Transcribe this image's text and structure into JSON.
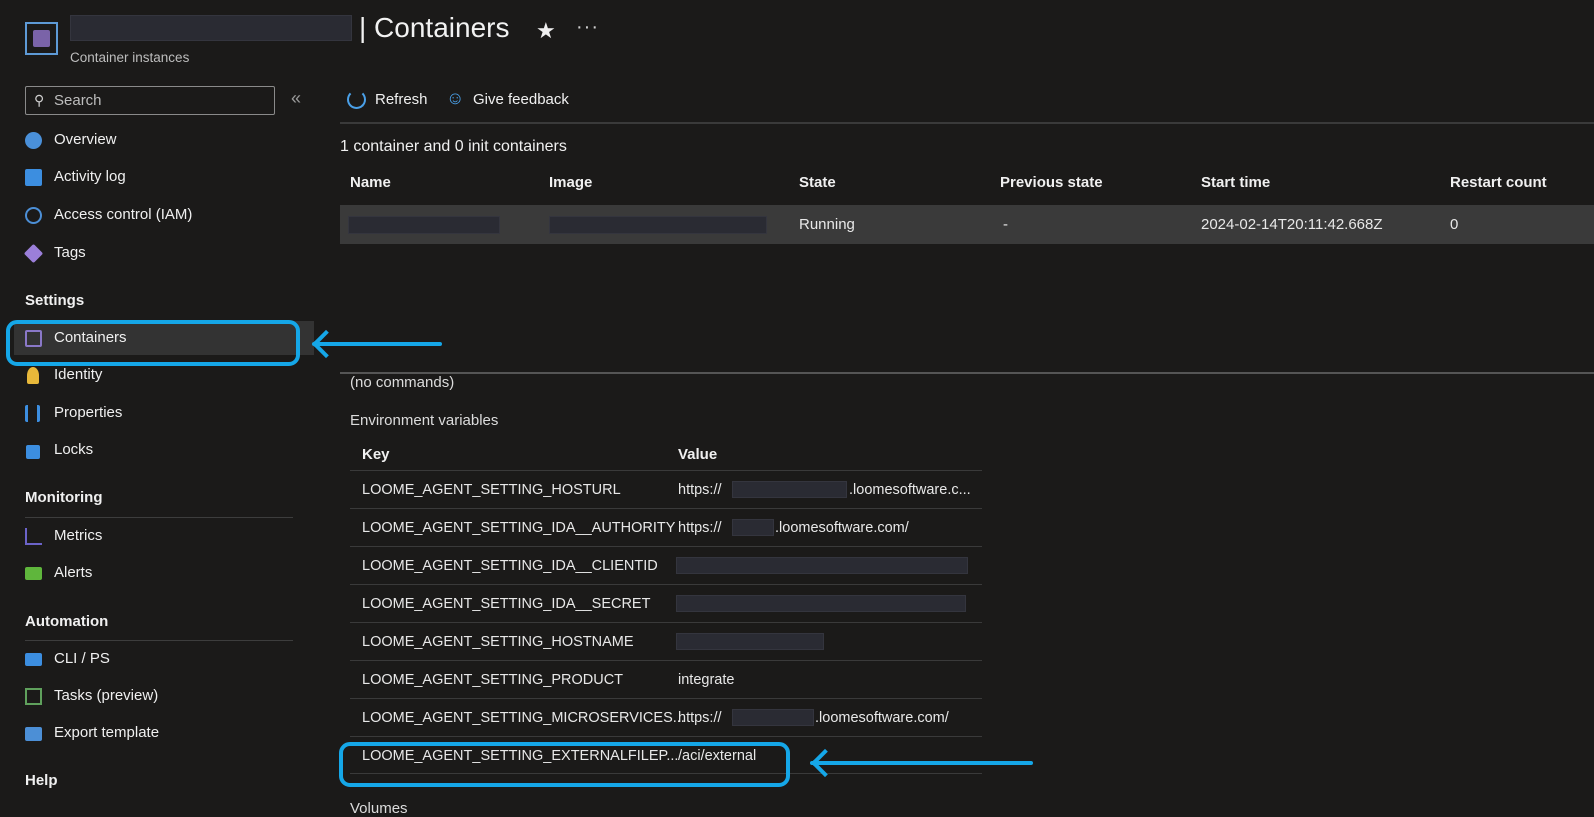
{
  "header": {
    "title": "| Containers",
    "resource_type": "Container instances",
    "favorite_icon": "star-icon",
    "more_icon": "ellipsis-icon"
  },
  "sidebar": {
    "search": {
      "placeholder": "Search",
      "value": ""
    },
    "collapse_icon": "double-chevron-left-icon",
    "items_top": [
      {
        "label": "Overview",
        "icon": "overview-icon",
        "color": "#4a90d9"
      },
      {
        "label": "Activity log",
        "icon": "activity-log-icon",
        "color": "#3c8ee0"
      },
      {
        "label": "Access control (IAM)",
        "icon": "people-icon",
        "color": "#4c8fd6"
      },
      {
        "label": "Tags",
        "icon": "tag-icon",
        "color": "#9b7fd9"
      }
    ],
    "sections": {
      "settings": "Settings",
      "monitoring": "Monitoring",
      "automation": "Automation",
      "help": "Help"
    },
    "settings_items": [
      {
        "label": "Containers",
        "icon": "container-icon",
        "color": "#7a63a8",
        "selected": true
      },
      {
        "label": "Identity",
        "icon": "key-icon",
        "color": "#e8b83a"
      },
      {
        "label": "Properties",
        "icon": "properties-icon",
        "color": "#3c8ee0"
      },
      {
        "label": "Locks",
        "icon": "lock-icon",
        "color": "#3c8ee0"
      }
    ],
    "monitoring_items": [
      {
        "label": "Metrics",
        "icon": "metrics-icon",
        "color": "#6b63c8"
      },
      {
        "label": "Alerts",
        "icon": "alerts-icon",
        "color": "#5fb63c"
      }
    ],
    "automation_items": [
      {
        "label": "CLI / PS",
        "icon": "terminal-icon",
        "color": "#3c8ee0"
      },
      {
        "label": "Tasks (preview)",
        "icon": "tasks-icon",
        "color": "#5fa05c"
      },
      {
        "label": "Export template",
        "icon": "export-icon",
        "color": "#4c8fd6"
      }
    ]
  },
  "toolbar": {
    "refresh_label": "Refresh",
    "feedback_label": "Give feedback"
  },
  "main": {
    "summary": "1 container and 0 init containers",
    "columns": [
      "Name",
      "Image",
      "State",
      "Previous state",
      "Start time",
      "Restart count"
    ],
    "rows": [
      {
        "name": "",
        "image": "",
        "state": "Running",
        "previous_state": "-",
        "start_time": "2024-02-14T20:11:42.668Z",
        "restart_count": "0"
      }
    ],
    "commands": "(no commands)",
    "env_heading": "Environment variables",
    "env_columns": [
      "Key",
      "Value"
    ],
    "env_vars": [
      {
        "key": "LOOME_AGENT_SETTING_HOSTURL",
        "value": "https://",
        "value_suffix": ".loomesoftware.c..."
      },
      {
        "key": "LOOME_AGENT_SETTING_IDA__AUTHORITY",
        "value": "https://",
        "value_suffix": ".loomesoftware.com/"
      },
      {
        "key": "LOOME_AGENT_SETTING_IDA__CLIENTID",
        "value": "",
        "value_suffix": ""
      },
      {
        "key": "LOOME_AGENT_SETTING_IDA__SECRET",
        "value": "",
        "value_suffix": ""
      },
      {
        "key": "LOOME_AGENT_SETTING_HOSTNAME",
        "value": "",
        "value_suffix": ""
      },
      {
        "key": "LOOME_AGENT_SETTING_PRODUCT",
        "value": "integrate",
        "value_suffix": ""
      },
      {
        "key": "LOOME_AGENT_SETTING_MICROSERVICES...",
        "value": "https://",
        "value_suffix": ".loomesoftware.com/"
      },
      {
        "key": "LOOME_AGENT_SETTING_EXTERNALFILEP...",
        "value": "/aci/external",
        "value_suffix": ""
      }
    ],
    "volumes_heading": "Volumes"
  },
  "colors": {
    "accent": "#15a7e8",
    "background": "#1b1a19",
    "row_selected": "#3a3a3a"
  }
}
